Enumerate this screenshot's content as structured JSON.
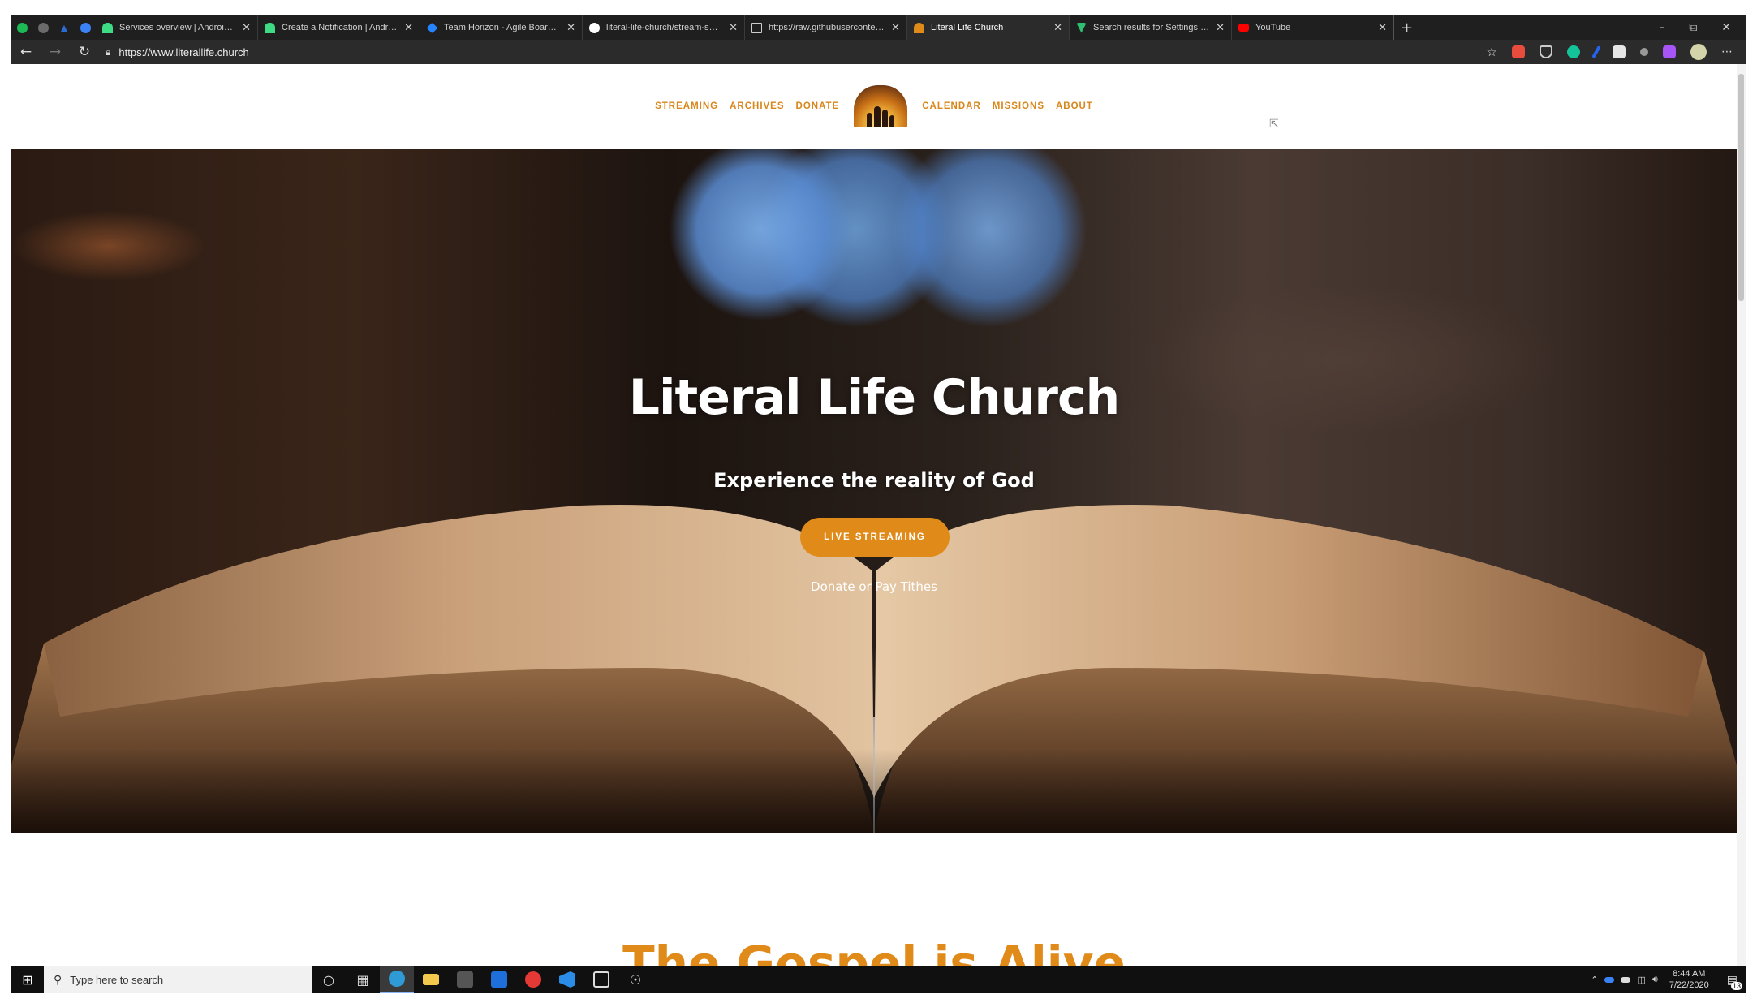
{
  "browser": {
    "tabs": [
      {
        "title": "Services overview | Android De",
        "fav": "#3ddc84"
      },
      {
        "title": "Create a Notification | Android",
        "fav": "#3ddc84"
      },
      {
        "title": "Team Horizon - Agile Board - Jir",
        "fav": "#2684ff"
      },
      {
        "title": "literal-life-church/stream-switch",
        "fav": "#ffffff"
      },
      {
        "title": "https://raw.githubusercontent.co",
        "fav": "#bbbbbb"
      },
      {
        "title": "Literal Life Church",
        "fav": "#e08a1a",
        "active": true
      },
      {
        "title": "Search results for Settings - Flati",
        "fav": "#2fbf71"
      },
      {
        "title": "YouTube",
        "fav": "#ff0000"
      }
    ],
    "url": "https://www.literallife.church",
    "new_tab": "+"
  },
  "site": {
    "nav_left": [
      "STREAMING",
      "ARCHIVES",
      "DONATE"
    ],
    "nav_right": [
      "CALENDAR",
      "MISSIONS",
      "ABOUT"
    ],
    "hero_title": "Literal Life Church",
    "hero_subtitle": "Experience the reality of God",
    "cta_label": "LIVE STREAMING",
    "donate_link": "Donate or Pay Tithes",
    "section_heading": "The Gospel is Alive"
  },
  "taskbar": {
    "search_placeholder": "Type here to search",
    "time": "8:44 AM",
    "date": "7/22/2020",
    "notif_count": "13"
  },
  "colors": {
    "accent": "#e08a1a",
    "nav": "#d9861a"
  }
}
